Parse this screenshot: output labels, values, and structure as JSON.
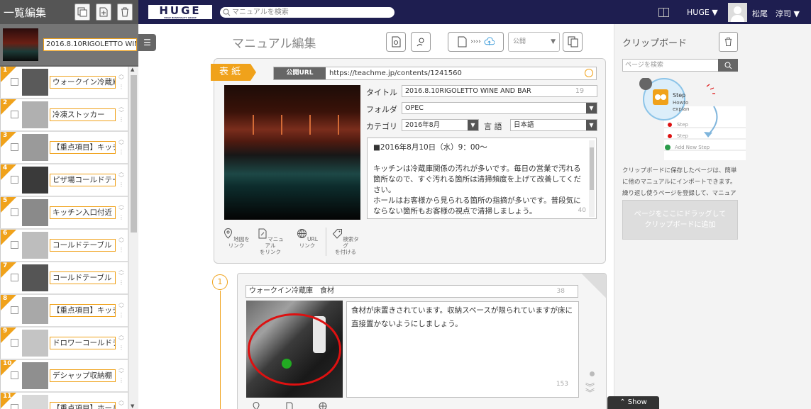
{
  "left": {
    "header": "一覧編集",
    "cover_title": "2016.8.10RIGOLETTO WINE AND BAR",
    "items": [
      {
        "num": "1",
        "label": "ウォークイン冷蔵庫"
      },
      {
        "num": "2",
        "label": "冷凍ストッカー"
      },
      {
        "num": "3",
        "label": "【重点項目】キッチ"
      },
      {
        "num": "4",
        "label": "ピザ場コールドテー"
      },
      {
        "num": "5",
        "label": "キッチン入口付近"
      },
      {
        "num": "6",
        "label": "コールドテーブル"
      },
      {
        "num": "7",
        "label": "コールドテーブル"
      },
      {
        "num": "8",
        "label": "【重点項目】キッチ"
      },
      {
        "num": "9",
        "label": "ドロワーコールドテ"
      },
      {
        "num": "10",
        "label": "デシャップ収納棚"
      },
      {
        "num": "11",
        "label": "【重点項目】ホール"
      }
    ]
  },
  "topnav": {
    "logo": "HUGE",
    "logo_sub": "HUGE HOSPITALITY GROUP",
    "search_placeholder": "マニュアルを検索",
    "org": "HUGE ▼",
    "user": "松尾　淳司 ▼"
  },
  "editor": {
    "title": "マニュアル編集",
    "publish_select": "公開",
    "cover_tag": "表紙",
    "url_label": "公開URL",
    "url": "https://teachme.jp/contents/1241560",
    "title_label": "タイトル",
    "title_value": "2016.8.10RIGOLETTO WINE AND BAR",
    "title_count": "19",
    "folder_label": "フォルダ",
    "folder_value": "OPEC",
    "category_label": "カテゴリ",
    "category_value": "2016年8月",
    "lang_label": "言 語",
    "lang_value": "日本語",
    "description": "■2016年8月10日（水）9：00〜\n\nキッチンは冷蔵庫関係の汚れが多いです。毎日の営業で汚れる箇所なので、すぐ汚れる箇所は清掃頻度を上げて改善してください。\nホールはお客様から見られる箇所の指摘が多いです。普段気にならない箇所もお客様の視点で清掃しましょう。",
    "desc_count": "40",
    "actions": [
      {
        "icon": "map-pin-icon",
        "label": "地図を\nリンク"
      },
      {
        "icon": "manual-link-icon",
        "label": "マニュアル\nをリンク"
      },
      {
        "icon": "globe-icon",
        "label": "URL\nリンク"
      },
      {
        "icon": "tag-icon",
        "label": "検索タグ\nを付ける"
      }
    ]
  },
  "step": {
    "number": "1",
    "title": "ウォークイン冷蔵庫　食材",
    "title_count": "38",
    "text": "食材が床置きされています。収納スペースが限られていますが床に直接置かないようにしましょう。",
    "text_count": "153"
  },
  "clipboard": {
    "title": "クリップボード",
    "search_placeholder": "ページを検索",
    "illus_step": "Step",
    "illus_howto": "Howto",
    "illus_explain": "explan",
    "illus_add": "Add New Step",
    "note": "クリップボードに保存したページは、簡単に他のマニュアルにインポートできます。繰り返し使うページを登録して、マニュアル",
    "drop": "ページをここにドラッグして\nクリップボードに追加"
  },
  "show_label": "Show",
  "colors": {
    "accent": "#f0a21b",
    "nav": "#1e1e50"
  }
}
